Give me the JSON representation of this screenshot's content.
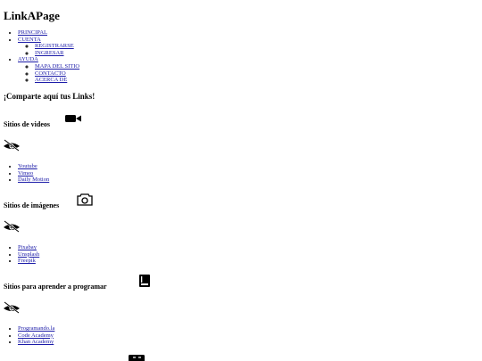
{
  "site": {
    "title": "LinkAPage"
  },
  "nav": {
    "items": [
      {
        "label": "PRINCIPAL"
      },
      {
        "label": "CUENTA",
        "children": [
          {
            "label": "REGISTRARSE"
          },
          {
            "label": "INGRESAR"
          }
        ]
      },
      {
        "label": "AYUDA",
        "children": [
          {
            "label": "MAPA DEL SITIO"
          },
          {
            "label": "CONTACTO"
          },
          {
            "label": "ACERCA DE"
          }
        ]
      }
    ]
  },
  "main": {
    "heading": "¡Comparte aquí tus Links!",
    "sections": [
      {
        "title": "Sitios de videos",
        "icon": "videocam-icon",
        "toggle_icon": "eye-off-icon",
        "links": [
          {
            "label": "Youtube"
          },
          {
            "label": "Vimeo"
          },
          {
            "label": "Daily Motion"
          }
        ]
      },
      {
        "title": "Sitios de imágenes",
        "icon": "camera-icon",
        "toggle_icon": "eye-off-icon",
        "links": [
          {
            "label": "Pixabay"
          },
          {
            "label": "Unsplash"
          },
          {
            "label": "Freepik"
          }
        ]
      },
      {
        "title": "Sitios para aprender a programar",
        "icon": "book-icon",
        "toggle_icon": "eye-off-icon",
        "links": [
          {
            "label": "Programando.la"
          },
          {
            "label": "Code Academy"
          },
          {
            "label": "Khan Academy"
          }
        ]
      },
      {
        "title": "",
        "icon": "closed-caption-icon"
      }
    ]
  },
  "colors": {
    "link": "#1b1ba8",
    "text": "#000000",
    "background": "#ffffff"
  }
}
